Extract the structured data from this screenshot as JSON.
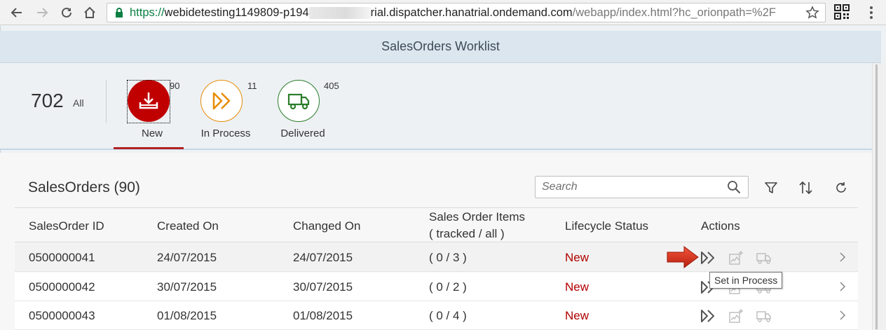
{
  "browser": {
    "url_scheme": "https://",
    "url_host_start": "webidetesting1149809-p194",
    "url_host_end": "rial.dispatcher.hanatrial.ondemand.com",
    "url_path": "/webapp/index.html?hc_orionpath=%2F"
  },
  "app": {
    "title": "SalesOrders Worklist"
  },
  "summary": {
    "total": "702",
    "total_label": "All"
  },
  "tabs": [
    {
      "label": "New",
      "count": "90",
      "icon": "download-icon",
      "color": "#c00000",
      "selected": true
    },
    {
      "label": "In Process",
      "count": "11",
      "icon": "fast-forward-icon",
      "color": "#e78c07"
    },
    {
      "label": "Delivered",
      "count": "405",
      "icon": "truck-icon",
      "color": "#2b7d2b"
    }
  ],
  "table": {
    "title": "SalesOrders (90)",
    "search_placeholder": "Search",
    "columns": {
      "id": "SalesOrder ID",
      "created": "Created On",
      "changed": "Changed On",
      "items_line1": "Sales Order Items",
      "items_line2": "( tracked / all )",
      "status": "Lifecycle Status",
      "actions": "Actions"
    },
    "rows": [
      {
        "id": "0500000041",
        "created": "24/07/2015",
        "changed": "24/07/2015",
        "items": "( 0 / 3 )",
        "status": "New"
      },
      {
        "id": "0500000042",
        "created": "30/07/2015",
        "changed": "30/07/2015",
        "items": "( 0 / 2 )",
        "status": "New"
      },
      {
        "id": "0500000043",
        "created": "01/08/2015",
        "changed": "01/08/2015",
        "items": "( 0 / 4 )",
        "status": "New"
      }
    ],
    "tooltip": "Set in Process"
  },
  "colors": {
    "status_new": "#b00000",
    "header_bg": "#dbe6ef",
    "accent_red": "#c00000"
  }
}
